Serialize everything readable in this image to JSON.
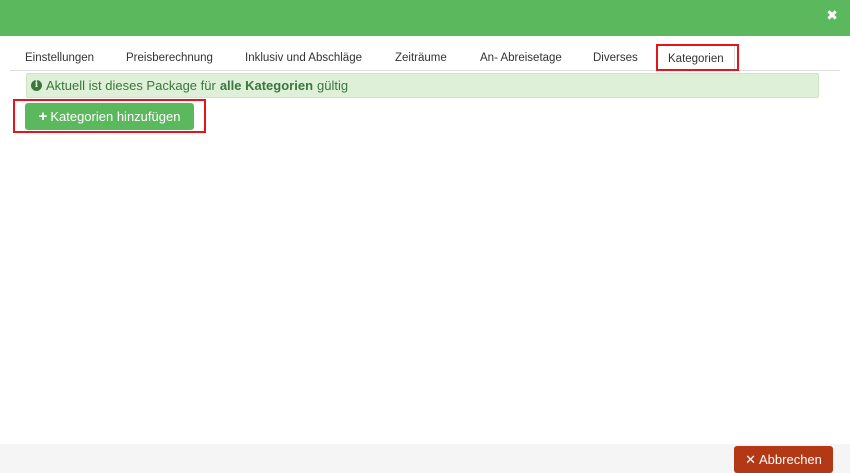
{
  "header": {
    "close_glyph": "✖"
  },
  "tabs": [
    {
      "label": "Einstellungen"
    },
    {
      "label": "Preisberechnung"
    },
    {
      "label": "Inklusiv und Abschläge"
    },
    {
      "label": "Zeiträume"
    },
    {
      "label": "An- Abreisetage"
    },
    {
      "label": "Diverses"
    },
    {
      "label": "Kategorien",
      "active": true
    }
  ],
  "alert": {
    "icon": "info-icon",
    "text_before": "Aktuell ist dieses Package für",
    "text_bold": "alle Kategorien",
    "text_after": "gültig"
  },
  "add_button": {
    "icon": "plus-icon",
    "label": "Kategorien hinzufügen"
  },
  "cancel_button": {
    "icon": "close-icon",
    "label": "Abbrechen"
  },
  "colors": {
    "header": "#5cb85c",
    "alert_bg": "#dff0d8",
    "alert_text": "#3c763d",
    "cancel_bg": "#b23816",
    "highlight": "#e3141b"
  }
}
